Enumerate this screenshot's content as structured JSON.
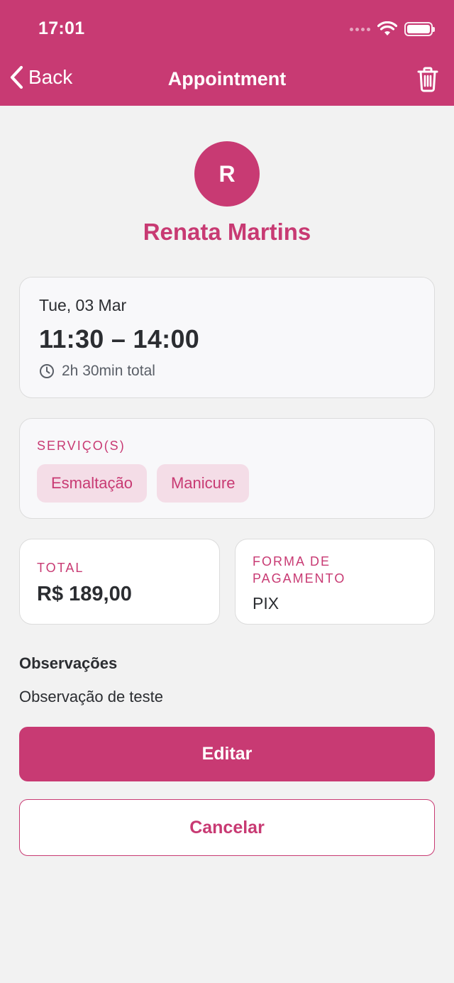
{
  "status_bar": {
    "time": "17:01",
    "icons": [
      "signal-icon",
      "wifi-icon",
      "battery-icon"
    ]
  },
  "nav": {
    "back_label": "Back",
    "title": "Appointment",
    "delete_icon": "trash-icon"
  },
  "client": {
    "initial": "R",
    "name": "Renata Martins"
  },
  "schedule": {
    "date": "Tue, 03 Mar",
    "time_range": "11:30 – 14:00",
    "duration": "2h 30min total",
    "duration_icon": "clock-icon"
  },
  "services": {
    "label": "SERVIÇO(S)",
    "items": [
      {
        "label": "Esmaltação"
      },
      {
        "label": "Manicure"
      }
    ]
  },
  "payment": {
    "total_label": "TOTAL",
    "total_value": "R$ 189,00",
    "method_label": "FORMA DE PAGAMENTO",
    "method_value": "PIX"
  },
  "notes": {
    "title": "Observações",
    "text": "Observação de teste"
  },
  "actions": {
    "edit_label": "Editar",
    "cancel_label": "Cancelar"
  },
  "colors": {
    "brand": "#c83a73",
    "background": "#f2f2f2",
    "chip_bg": "#f4dde7",
    "text": "#2b2d31"
  }
}
